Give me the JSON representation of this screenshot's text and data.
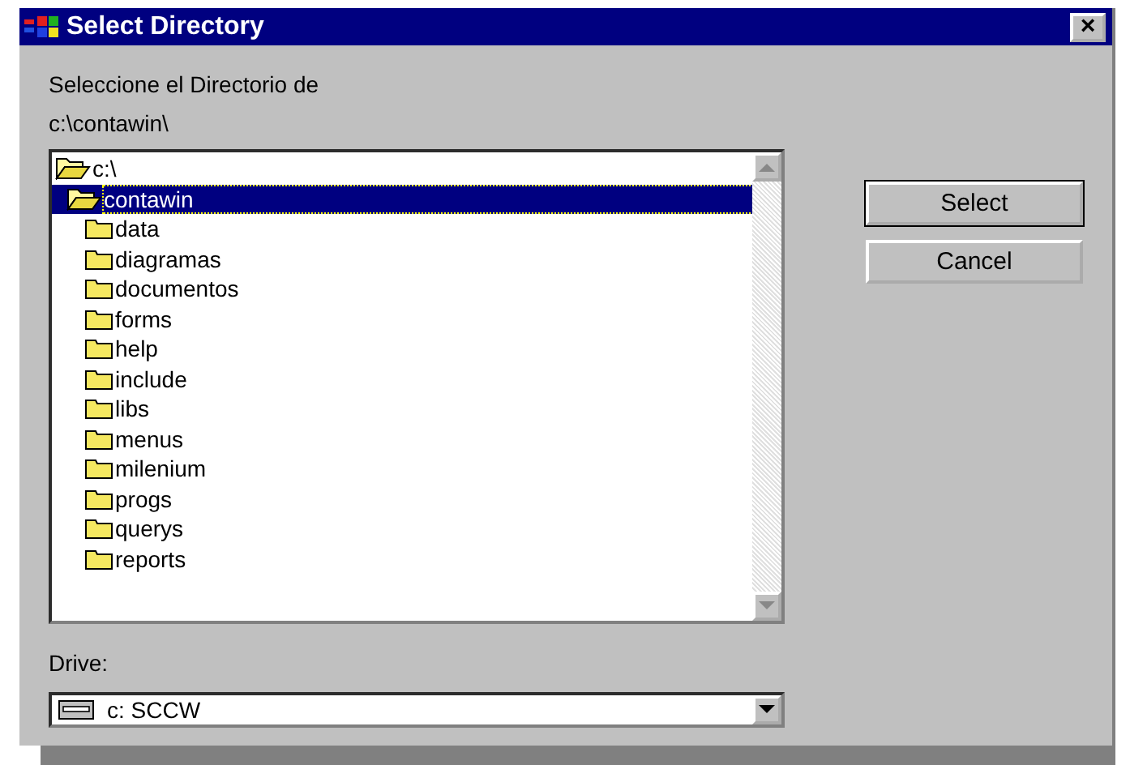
{
  "window": {
    "title": "Select Directory",
    "close": "×"
  },
  "prompt": "Seleccione el Directorio de",
  "current_path": "c:\\contawin\\",
  "tree": [
    {
      "label": "c:\\",
      "expanded": true,
      "selected": false,
      "children": [
        {
          "label": "contawin",
          "expanded": true,
          "selected": true,
          "children": [
            {
              "label": "data",
              "expanded": false,
              "selected": false
            },
            {
              "label": "diagramas",
              "expanded": false,
              "selected": false
            },
            {
              "label": "documentos",
              "expanded": false,
              "selected": false
            },
            {
              "label": "forms",
              "expanded": false,
              "selected": false
            },
            {
              "label": "help",
              "expanded": false,
              "selected": false
            },
            {
              "label": "include",
              "expanded": false,
              "selected": false
            },
            {
              "label": "libs",
              "expanded": false,
              "selected": false
            },
            {
              "label": "menus",
              "expanded": false,
              "selected": false
            },
            {
              "label": "milenium",
              "expanded": false,
              "selected": false
            },
            {
              "label": "progs",
              "expanded": false,
              "selected": false
            },
            {
              "label": "querys",
              "expanded": false,
              "selected": false
            },
            {
              "label": "reports",
              "expanded": false,
              "selected": false
            }
          ]
        }
      ]
    }
  ],
  "buttons": [
    {
      "label": "Select",
      "default": true
    },
    {
      "label": "Cancel",
      "default": false
    }
  ],
  "drive": {
    "label": "Drive:",
    "value": "c: SCCW"
  }
}
